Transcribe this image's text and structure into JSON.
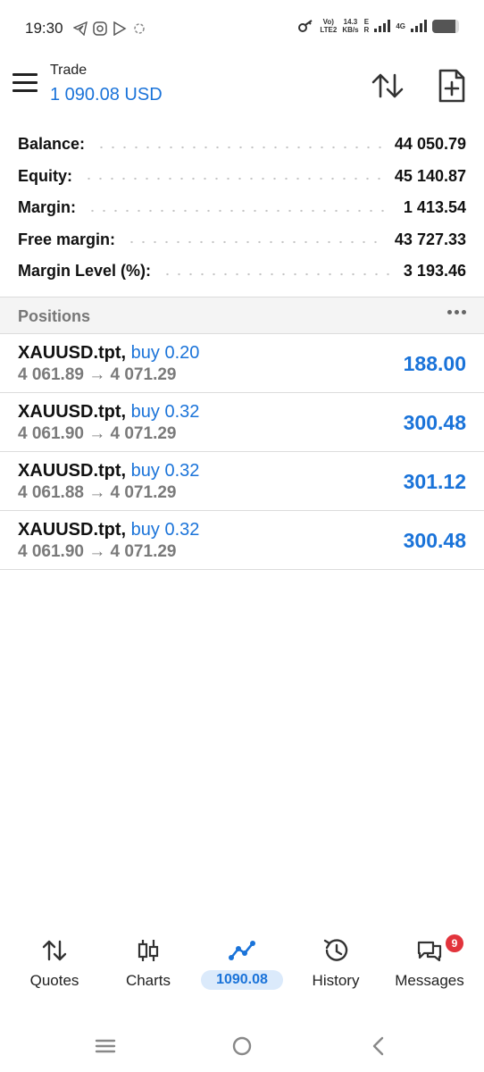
{
  "status_bar": {
    "time": "19:30",
    "volte": "Vo)\nLTE2",
    "speed": "14.3\nKB/s",
    "net_e": "E\nR",
    "net_4g": "4G",
    "battery_level": 0.85
  },
  "header": {
    "title": "Trade",
    "balance_display": "1 090.08 USD",
    "sort_icon": "sort-arrows-icon",
    "new_order_icon": "new-document-icon"
  },
  "account": [
    {
      "label": "Balance:",
      "value": "44 050.79"
    },
    {
      "label": "Equity:",
      "value": "45 140.87"
    },
    {
      "label": "Margin:",
      "value": "1 413.54"
    },
    {
      "label": "Free margin:",
      "value": "43 727.33"
    },
    {
      "label": "Margin Level (%):",
      "value": "3 193.46"
    }
  ],
  "positions_header": {
    "label": "Positions"
  },
  "positions": [
    {
      "symbol": "XAUUSD.tpt,",
      "side": "buy 0.20",
      "prices": "4 061.89 → 4 071.29",
      "profit": "188.00"
    },
    {
      "symbol": "XAUUSD.tpt,",
      "side": "buy 0.32",
      "prices": "4 061.90 → 4 071.29",
      "profit": "300.48"
    },
    {
      "symbol": "XAUUSD.tpt,",
      "side": "buy 0.32",
      "prices": "4 061.88 → 4 071.29",
      "profit": "301.12"
    },
    {
      "symbol": "XAUUSD.tpt,",
      "side": "buy 0.32",
      "prices": "4 061.90 → 4 071.29",
      "profit": "300.48"
    }
  ],
  "nav": {
    "quotes": "Quotes",
    "charts": "Charts",
    "trade": "1090.08",
    "history": "History",
    "messages": "Messages",
    "messages_badge": "9"
  },
  "colors": {
    "accent": "#1a73d9",
    "badge": "#e2343c",
    "muted": "#7a7a7a"
  }
}
